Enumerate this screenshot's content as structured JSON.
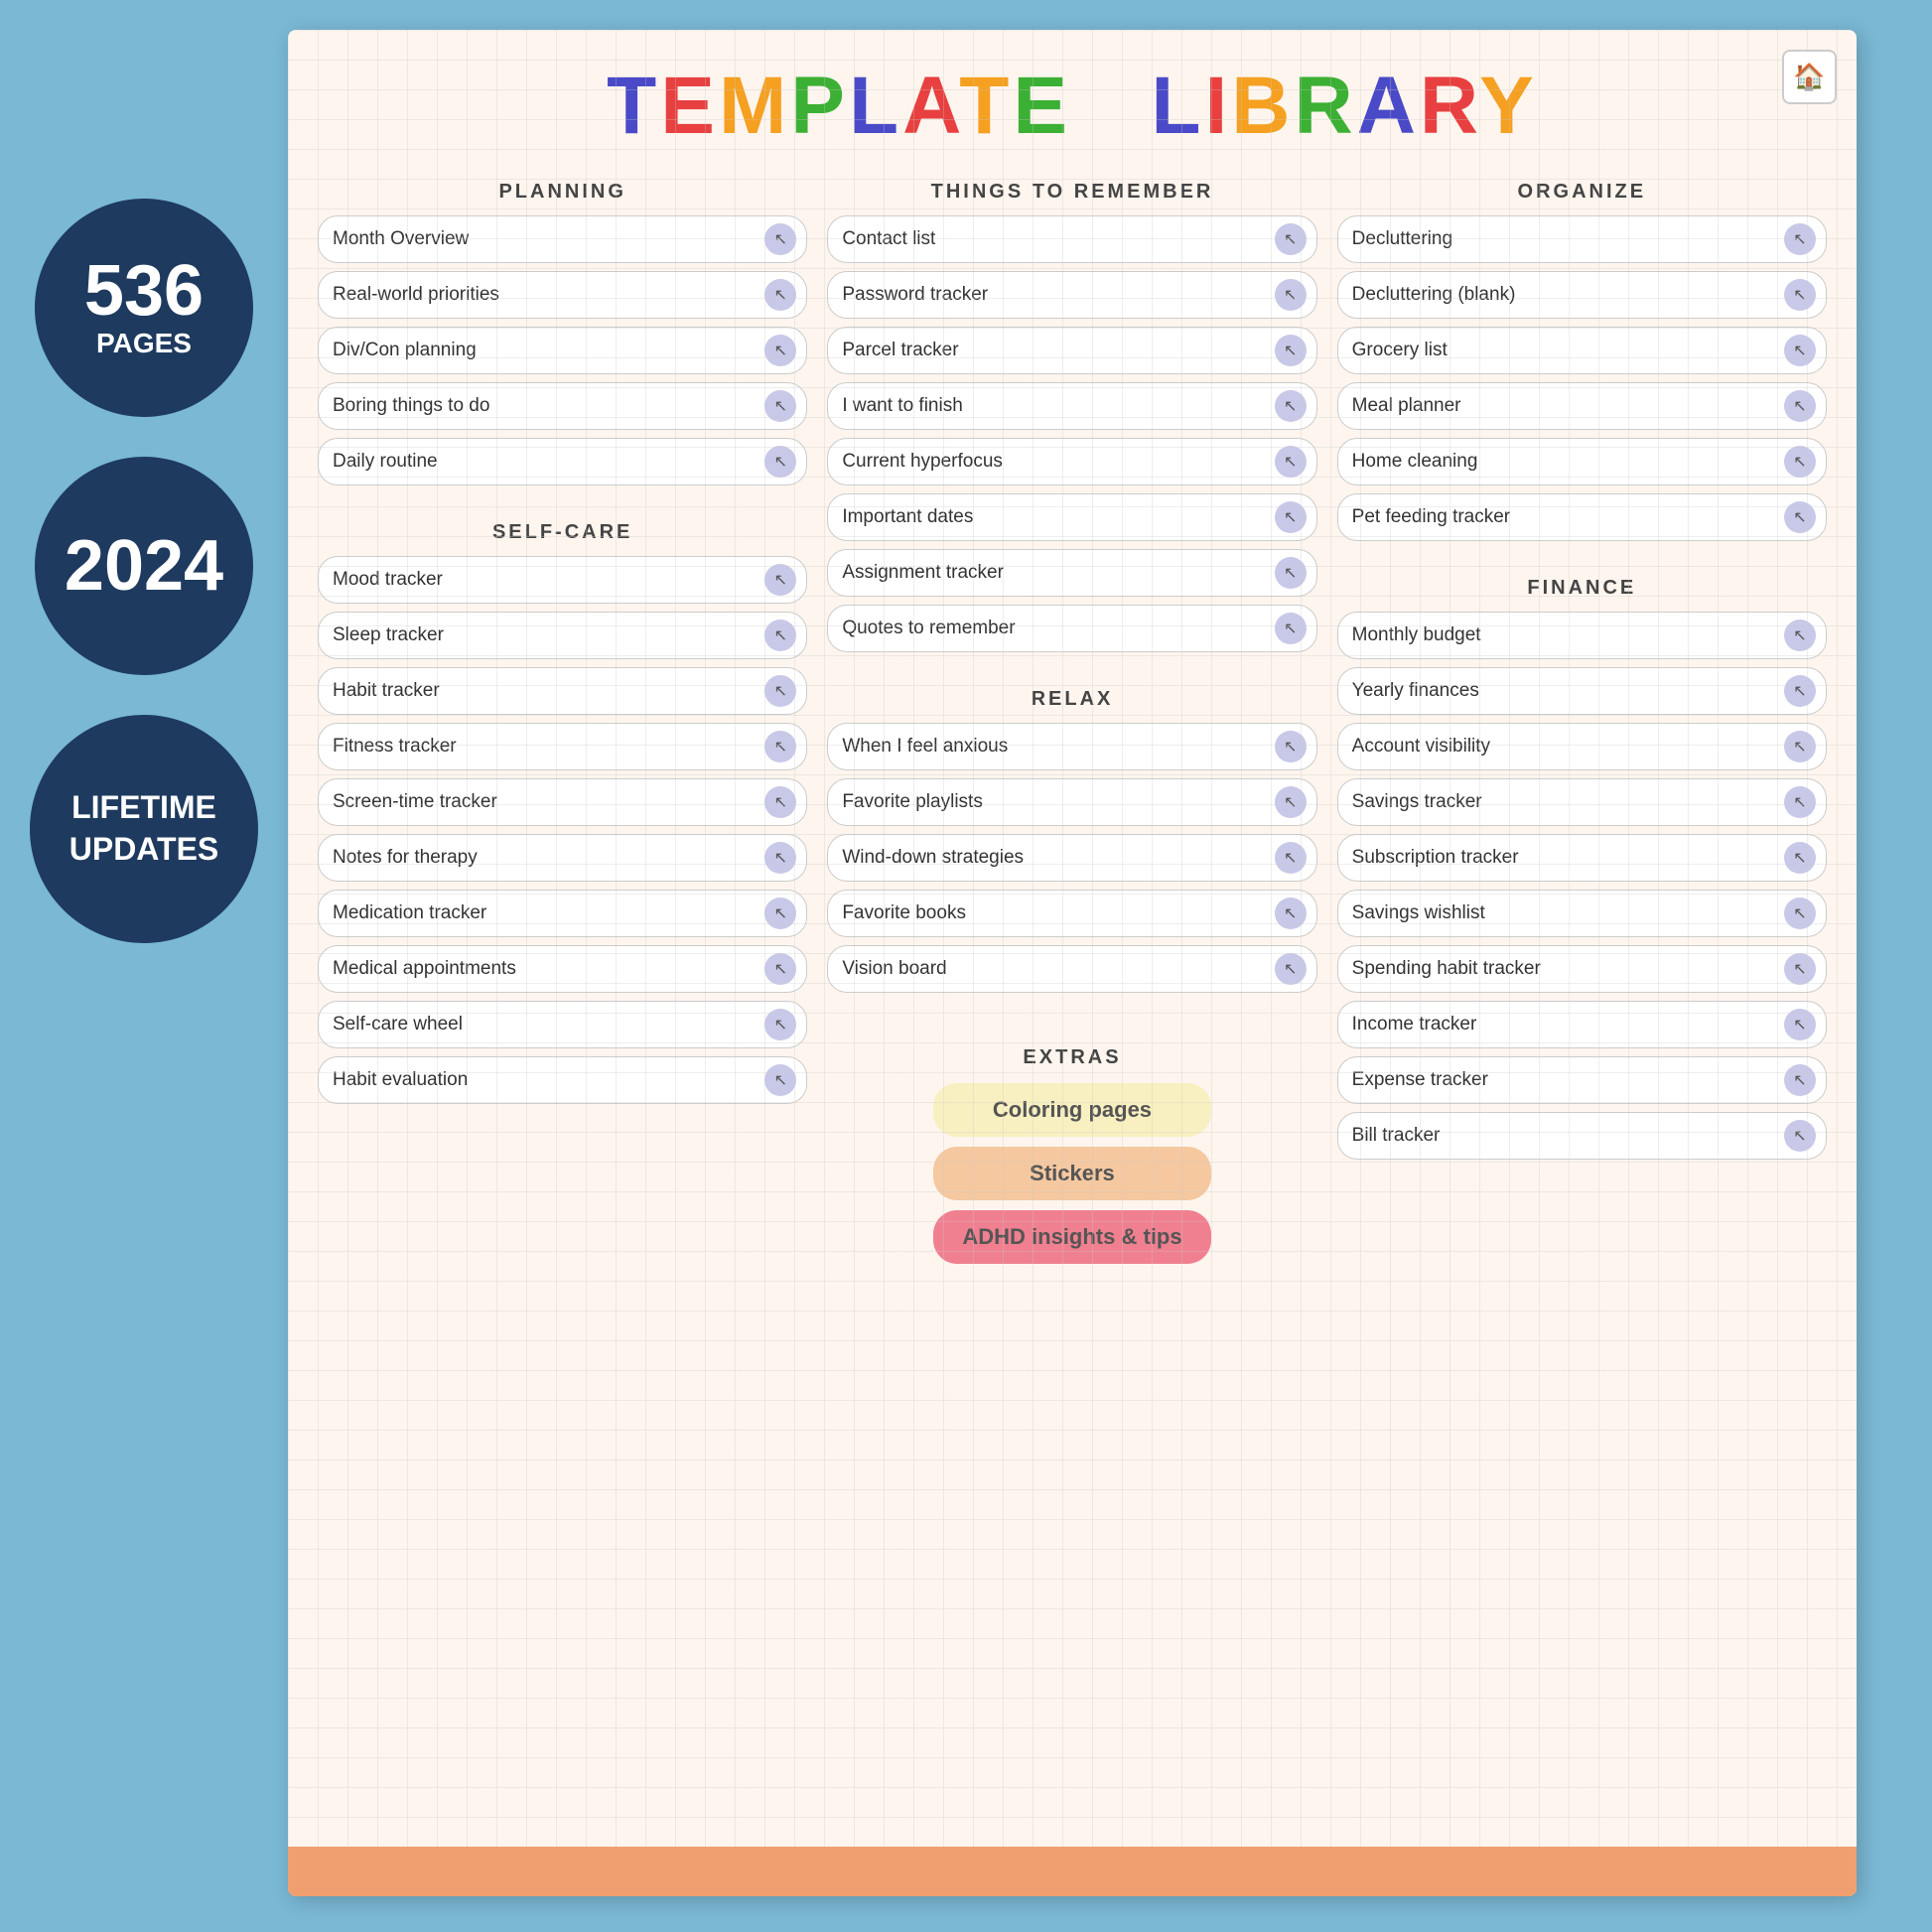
{
  "badges": [
    {
      "id": "pages-badge",
      "number": "536",
      "label": "PAGES"
    },
    {
      "id": "year-badge",
      "number": "2024",
      "label": ""
    },
    {
      "id": "updates-badge",
      "number": "",
      "label": "LIFETIME\nUPDATES"
    }
  ],
  "home_button": "🏠",
  "title": {
    "letters": [
      "T",
      "E",
      "M",
      "P",
      "L",
      "A",
      "T",
      "E",
      " ",
      "L",
      "I",
      "B",
      "R",
      "A",
      "R",
      "Y"
    ]
  },
  "columns": {
    "planning": {
      "header": "PLANNING",
      "items": [
        "Month Overview",
        "Real-world priorities",
        "Div/Con planning",
        "Boring things to do",
        "Daily routine"
      ]
    },
    "things_to_remember": {
      "header": "THINGS TO REMEMBER",
      "items": [
        "Contact list",
        "Password tracker",
        "Parcel tracker",
        "I want to finish",
        "Current hyperfocus",
        "Important dates",
        "Assignment tracker",
        "Quotes to remember"
      ],
      "relax_header": "RELAX",
      "relax_items": [
        "When I feel anxious",
        "Favorite playlists",
        "Wind-down strategies",
        "Favorite books",
        "Vision board"
      ]
    },
    "organize": {
      "header": "ORGANIZE",
      "items": [
        "Decluttering",
        "Decluttering (blank)",
        "Grocery list",
        "Meal planner",
        "Home cleaning",
        "Pet feeding tracker"
      ],
      "finance_header": "FINANCE",
      "finance_items": [
        "Monthly budget",
        "Yearly finances",
        "Account visibility",
        "Savings tracker",
        "Subscription tracker",
        "Savings wishlist",
        "Spending habit tracker",
        "Income tracker",
        "Expense tracker",
        "Bill tracker"
      ]
    },
    "self_care": {
      "header": "SELF-CARE",
      "items": [
        "Mood tracker",
        "Sleep tracker",
        "Habit tracker",
        "Fitness tracker",
        "Screen-time tracker",
        "Notes for therapy",
        "Medication tracker",
        "Medical appointments",
        "Self-care wheel",
        "Habit evaluation"
      ]
    }
  },
  "extras": {
    "header": "EXTRAS",
    "items": [
      {
        "label": "Coloring pages",
        "style": "yellow"
      },
      {
        "label": "Stickers",
        "style": "orange"
      },
      {
        "label": "ADHD insights & tips",
        "style": "pink"
      }
    ]
  }
}
